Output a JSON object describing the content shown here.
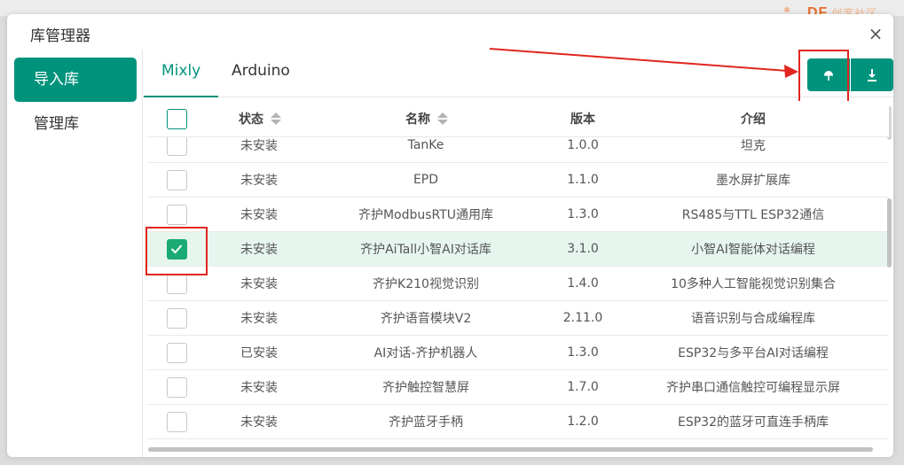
{
  "background": {
    "logo_text": "DF",
    "logo_faint": "创客社区"
  },
  "dialog": {
    "title": "库管理器",
    "close_symbol": "×"
  },
  "sidebar": {
    "items": [
      {
        "label": "导入库",
        "active": true
      },
      {
        "label": "管理库",
        "active": false
      }
    ]
  },
  "tabs": [
    {
      "label": "Mixly",
      "active": true
    },
    {
      "label": "Arduino",
      "active": false
    }
  ],
  "toolbar": {
    "buttons": [
      {
        "icon": "cloud-import-icon"
      },
      {
        "icon": "download-icon"
      }
    ]
  },
  "table": {
    "headers": [
      "状态",
      "名称",
      "版本",
      "介绍"
    ],
    "rows": [
      {
        "status": "未安装",
        "name": "TanKe",
        "version": "1.0.0",
        "desc": "坦克",
        "checked": false
      },
      {
        "status": "未安装",
        "name": "EPD",
        "version": "1.1.0",
        "desc": "墨水屏扩展库",
        "checked": false
      },
      {
        "status": "未安装",
        "name": "齐护ModbusRTU通用库",
        "version": "1.3.0",
        "desc": "RS485与TTL ESP32通信",
        "checked": false
      },
      {
        "status": "未安装",
        "name": "齐护AiTall小智AI对话库",
        "version": "3.1.0",
        "desc": "小智AI智能体对话编程",
        "checked": true
      },
      {
        "status": "未安装",
        "name": "齐护K210视觉识别",
        "version": "1.4.0",
        "desc": "10多种人工智能视觉识别集合",
        "checked": false
      },
      {
        "status": "未安装",
        "name": "齐护语音模块V2",
        "version": "2.11.0",
        "desc": "语音识别与合成编程库",
        "checked": false
      },
      {
        "status": "已安装",
        "name": "AI对话-齐护机器人",
        "version": "1.3.0",
        "desc": "ESP32与多平台AI对话编程",
        "checked": false
      },
      {
        "status": "未安装",
        "name": "齐护触控智慧屏",
        "version": "1.7.0",
        "desc": "齐护串口通信触控可编程显示屏",
        "checked": false
      },
      {
        "status": "未安装",
        "name": "齐护蓝牙手柄",
        "version": "1.2.0",
        "desc": "ESP32的蓝牙可直连手柄库",
        "checked": false
      }
    ]
  },
  "colors": {
    "accent": "#00937c",
    "checkbox_checked": "#1aaa73",
    "selected_row": "#e6f6ef",
    "annotation": "#e0261e"
  }
}
